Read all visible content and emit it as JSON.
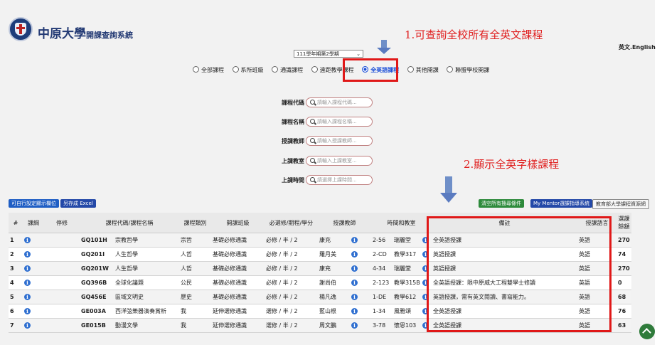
{
  "header": {
    "brand_big": "中原大學",
    "brand_small": "開課查詢系統",
    "lang_link": "英文.English"
  },
  "annotations": {
    "note1": "1.可查詢全校所有全英文課程",
    "note2": "2.顯示全英字樣課程"
  },
  "semester": {
    "selected": "111學年期第2學期"
  },
  "course_types": [
    {
      "label": "全部課程",
      "selected": false
    },
    {
      "label": "系所班級",
      "selected": false
    },
    {
      "label": "通識課程",
      "selected": false
    },
    {
      "label": "遠距教學課程",
      "selected": false
    },
    {
      "label": "全英語課程",
      "selected": true
    },
    {
      "label": "其他開課",
      "selected": false
    },
    {
      "label": "聯盟學校開課",
      "selected": false
    }
  ],
  "search_fields": [
    {
      "label": "課程代碼",
      "placeholder": "請輸入課程代碼..."
    },
    {
      "label": "課程名稱",
      "placeholder": "請輸入課程名稱..."
    },
    {
      "label": "授課教師",
      "placeholder": "請輸入授課教師..."
    },
    {
      "label": "上課教室",
      "placeholder": "請輸入上課教室..."
    },
    {
      "label": "上課時間",
      "placeholder": "請選擇上課時間..."
    }
  ],
  "buttons": {
    "columns": "可自行設定顯示欄位",
    "export": "另存成 Excel",
    "clear_filters": "清空所有搜尋條件",
    "mentor": "My Mentor選課指導系統",
    "moe": "教育部大學課程資源網"
  },
  "table": {
    "headers": [
      "#",
      "課綱",
      "停修",
      "課程代碼/課程名稱",
      "課程類別",
      "開課班級",
      "必選修/期程/學分",
      "授課教師",
      "時間和教室",
      "備註",
      "授課語言",
      "選課餘額"
    ],
    "rows": [
      {
        "n": "1",
        "code": "GQ101H",
        "name": "宗教哲學",
        "cat": "宗哲",
        "cls": "基礎必修通識",
        "req": "必修 / 半 / 2",
        "teacher": "康充",
        "time": "2-56",
        "room": "瑞麗堂",
        "note": "全英語授課",
        "lang": "英語",
        "seats": "270"
      },
      {
        "n": "2",
        "code": "GQ201I",
        "name": "人生哲學",
        "cat": "人哲",
        "cls": "基礎必修通識",
        "req": "必修 / 半 / 2",
        "teacher": "羅月美",
        "time": "2-CD",
        "room": "教學317",
        "note": "英語授課",
        "lang": "英語",
        "seats": "74"
      },
      {
        "n": "3",
        "code": "GQ201W",
        "name": "人生哲學",
        "cat": "人哲",
        "cls": "基礎必修通識",
        "req": "必修 / 半 / 2",
        "teacher": "康充",
        "time": "4-34",
        "room": "瑞麗堂",
        "note": "英語授課",
        "lang": "英語",
        "seats": "270"
      },
      {
        "n": "4",
        "code": "GQ396B",
        "name": "全球化議題",
        "cat": "公民",
        "cls": "基礎必修通識",
        "req": "必修 / 半 / 2",
        "teacher": "謝尚伯",
        "time": "2-123",
        "room": "教學315B",
        "note": "全英語授課：限中原威大工程雙學士修讀",
        "lang": "英語",
        "seats": "0"
      },
      {
        "n": "5",
        "code": "GQ456E",
        "name": "區域文明史",
        "cat": "歷史",
        "cls": "基礎必修通識",
        "req": "必修 / 半 / 2",
        "teacher": "楊凡逸",
        "time": "1-DE",
        "room": "教學612",
        "note": "英語授課，需有英文閱讀、書寫能力。",
        "lang": "英語",
        "seats": "68"
      },
      {
        "n": "6",
        "code": "GE003A",
        "name": "西洋弦樂器演奏賞析",
        "cat": "我",
        "cls": "延伸選修通識",
        "req": "選修 / 半 / 2",
        "teacher": "藍山根",
        "time": "1-34",
        "room": "風雅頌",
        "note": "全英語授課",
        "lang": "英語",
        "seats": "76"
      },
      {
        "n": "7",
        "code": "GE015B",
        "name": "動漫文學",
        "cat": "我",
        "cls": "延伸選修通識",
        "req": "選修 / 半 / 2",
        "teacher": "周文鵬",
        "time": "3-78",
        "room": "懷恩103",
        "note": "全英語授課",
        "lang": "英語",
        "seats": "63"
      }
    ]
  }
}
